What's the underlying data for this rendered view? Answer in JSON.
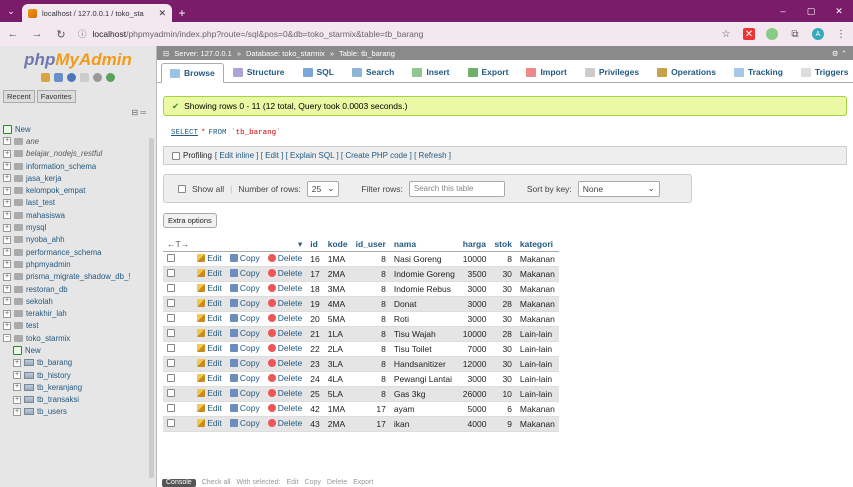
{
  "browser": {
    "tab_title": "localhost / 127.0.0.1 / toko_sta",
    "url_host": "localhost",
    "url_path": "/phpmyadmin/index.php?route=/sql&pos=0&db=toko_starmix&table=tb_barang"
  },
  "logo": {
    "php": "php",
    "my": "MyAdmin",
    "suffix": ""
  },
  "left": {
    "recent": "Recent",
    "favorites": "Favorites",
    "tree": [
      {
        "label": "New",
        "kind": "new"
      },
      {
        "label": "ane",
        "kind": "db-italic"
      },
      {
        "label": "belajar_nodejs_restful",
        "kind": "db-italic"
      },
      {
        "label": "information_schema",
        "kind": "db"
      },
      {
        "label": "jasa_kerja",
        "kind": "db"
      },
      {
        "label": "kelompok_empat",
        "kind": "db"
      },
      {
        "label": "last_test",
        "kind": "db"
      },
      {
        "label": "mahasiswa",
        "kind": "db"
      },
      {
        "label": "mysql",
        "kind": "db"
      },
      {
        "label": "nyoba_ahh",
        "kind": "db"
      },
      {
        "label": "performance_schema",
        "kind": "db"
      },
      {
        "label": "phpmyadmin",
        "kind": "db"
      },
      {
        "label": "prisma_migrate_shadow_db_!",
        "kind": "db"
      },
      {
        "label": "restoran_db",
        "kind": "db"
      },
      {
        "label": "sekolah",
        "kind": "db"
      },
      {
        "label": "terakhir_lah",
        "kind": "db"
      },
      {
        "label": "test",
        "kind": "db"
      },
      {
        "label": "toko_starmix",
        "kind": "db-open"
      },
      {
        "label": "New",
        "kind": "sub-new"
      },
      {
        "label": "tb_barang",
        "kind": "table"
      },
      {
        "label": "tb_history",
        "kind": "table"
      },
      {
        "label": "tb_keranjang",
        "kind": "table"
      },
      {
        "label": "tb_transaksi",
        "kind": "table"
      },
      {
        "label": "tb_users",
        "kind": "table"
      }
    ]
  },
  "breadcrumb": {
    "server": "Server: 127.0.0.1",
    "database": "Database: toko_starmix",
    "table": "Table: tb_barang"
  },
  "tabs": [
    "Browse",
    "Structure",
    "SQL",
    "Search",
    "Insert",
    "Export",
    "Import",
    "Privileges",
    "Operations",
    "Tracking",
    "Triggers"
  ],
  "message": "Showing rows 0 - 11 (12 total, Query took 0.0003 seconds.)",
  "sql": {
    "select": "SELECT",
    "star": "*",
    "from": "FROM",
    "table": "`tb_barang`"
  },
  "profiling": {
    "label": "Profiling",
    "links": "[ Edit inline ] [ Edit ] [ Explain SQL ] [ Create PHP code ] [ Refresh ]"
  },
  "nav": {
    "show_all": "Show all",
    "rows_label": "Number of rows:",
    "rows_value": "25",
    "filter_label": "Filter rows:",
    "filter_placeholder": "Search this table",
    "sort_label": "Sort by key:",
    "sort_value": "None"
  },
  "extra_options": "Extra options",
  "table": {
    "columns": [
      "id",
      "kode",
      "id_user",
      "nama",
      "harga",
      "stok",
      "kategori"
    ],
    "actions": {
      "edit": "Edit",
      "copy": "Copy",
      "delete": "Delete"
    },
    "rows": [
      [
        "16",
        "1MA",
        "8",
        "Nasi Goreng",
        "10000",
        "8",
        "Makanan"
      ],
      [
        "17",
        "2MA",
        "8",
        "Indomie Goreng",
        "3500",
        "30",
        "Makanan"
      ],
      [
        "18",
        "3MA",
        "8",
        "Indomie Rebus",
        "3000",
        "30",
        "Makanan"
      ],
      [
        "19",
        "4MA",
        "8",
        "Donat",
        "3000",
        "28",
        "Makanan"
      ],
      [
        "20",
        "5MA",
        "8",
        "Roti",
        "3000",
        "30",
        "Makanan"
      ],
      [
        "21",
        "1LA",
        "8",
        "Tisu Wajah",
        "10000",
        "28",
        "Lain-lain"
      ],
      [
        "22",
        "2LA",
        "8",
        "Tisu Toilet",
        "7000",
        "30",
        "Lain-lain"
      ],
      [
        "23",
        "3LA",
        "8",
        "Handsanitizer",
        "12000",
        "30",
        "Lain-lain"
      ],
      [
        "24",
        "4LA",
        "8",
        "Pewangi Lantai",
        "3000",
        "30",
        "Lain-lain"
      ],
      [
        "25",
        "5LA",
        "8",
        "Gas 3kg",
        "26000",
        "10",
        "Lain-lain"
      ],
      [
        "42",
        "1MA",
        "17",
        "ayam",
        "5000",
        "6",
        "Makanan"
      ],
      [
        "43",
        "2MA",
        "17",
        "ikan",
        "4000",
        "9",
        "Makanan"
      ]
    ]
  },
  "footer": {
    "console": "Console",
    "check_all": "Check all",
    "with_selected": "With selected:",
    "edit": "Edit",
    "copy": "Copy",
    "delete": "Delete",
    "export": "Export"
  }
}
